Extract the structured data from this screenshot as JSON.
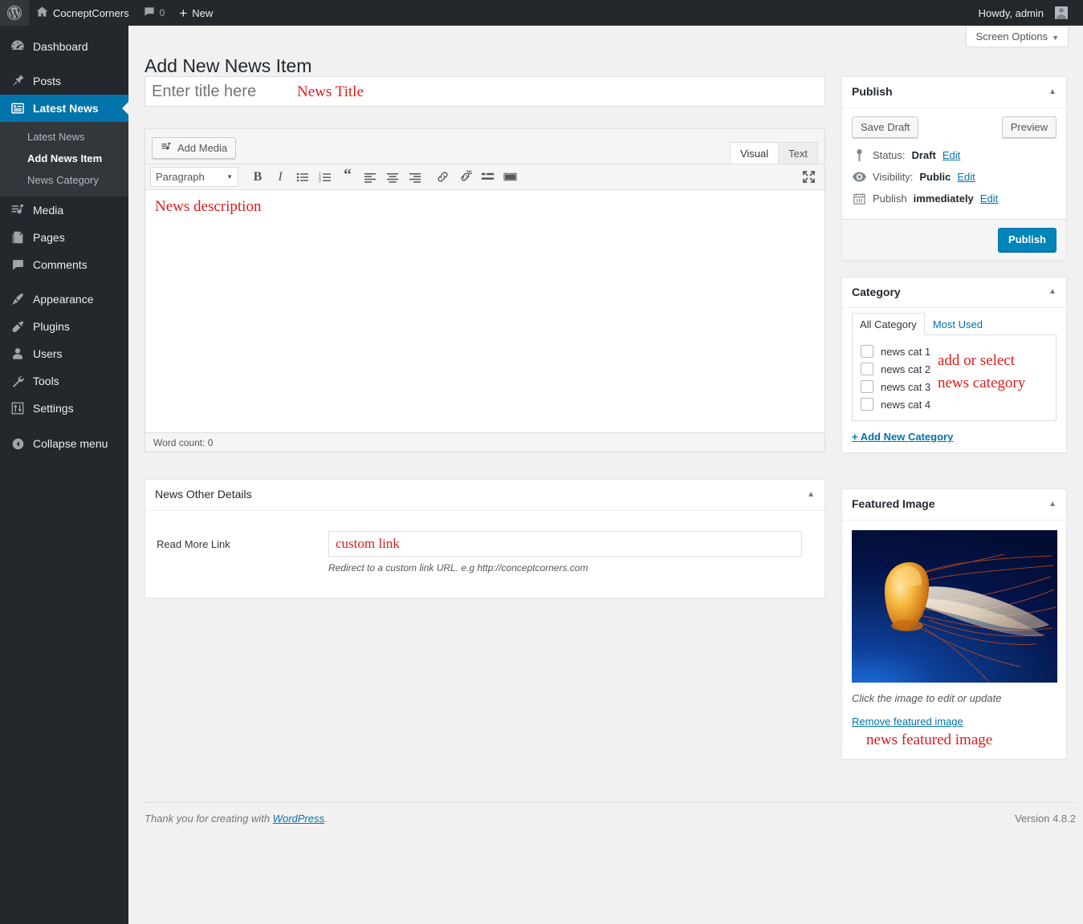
{
  "adminbar": {
    "logo_icon": "wordpress-logo-icon",
    "site_name": "CocneptCorners",
    "site_icon": "home-icon",
    "comments_icon": "comment-bubble-icon",
    "comment_count": "0",
    "new_icon": "plus-icon",
    "new_label": "New",
    "howdy": "Howdy, admin",
    "avatar_icon": "user-avatar-icon"
  },
  "sidebar": {
    "items": [
      {
        "label": "Dashboard",
        "icon": "dashboard-icon",
        "active": false
      },
      {
        "label": "Posts",
        "icon": "pin-icon",
        "active": false
      },
      {
        "label": "Latest News",
        "icon": "list-view-icon",
        "active": true
      },
      {
        "label": "Media",
        "icon": "media-icon",
        "active": false
      },
      {
        "label": "Pages",
        "icon": "pages-icon",
        "active": false
      },
      {
        "label": "Comments",
        "icon": "comment-bubble-icon",
        "active": false
      },
      {
        "label": "Appearance",
        "icon": "paintbrush-icon",
        "active": false
      },
      {
        "label": "Plugins",
        "icon": "plug-icon",
        "active": false
      },
      {
        "label": "Users",
        "icon": "user-icon",
        "active": false
      },
      {
        "label": "Tools",
        "icon": "wrench-icon",
        "active": false
      },
      {
        "label": "Settings",
        "icon": "sliders-icon",
        "active": false
      }
    ],
    "submenu": [
      {
        "label": "Latest News",
        "current": false
      },
      {
        "label": "Add News Item",
        "current": true
      },
      {
        "label": "News Category",
        "current": false
      }
    ],
    "collapse_label": "Collapse menu",
    "collapse_icon": "arrow-left-circle-icon"
  },
  "header": {
    "screen_options_label": "Screen Options",
    "screen_options_caret": "chevron-down-icon",
    "page_title": "Add New News Item"
  },
  "title_field": {
    "placeholder": "Enter title here",
    "value": "",
    "annotation": "News Title"
  },
  "editor": {
    "add_media_label": "Add Media",
    "add_media_icon": "media-add-icon",
    "tabs": [
      {
        "label": "Visual",
        "active": true
      },
      {
        "label": "Text",
        "active": false
      }
    ],
    "format_select": "Paragraph",
    "toolbar_buttons": [
      {
        "name": "bold-icon",
        "glyph": "B"
      },
      {
        "name": "italic-icon",
        "glyph": "I"
      },
      {
        "name": "bulleted-list-icon",
        "glyph": ""
      },
      {
        "name": "numbered-list-icon",
        "glyph": ""
      },
      {
        "name": "blockquote-icon",
        "glyph": "“"
      },
      {
        "name": "align-left-icon",
        "glyph": ""
      },
      {
        "name": "align-center-icon",
        "glyph": ""
      },
      {
        "name": "align-right-icon",
        "glyph": ""
      },
      {
        "name": "link-icon",
        "glyph": ""
      },
      {
        "name": "unlink-icon",
        "glyph": ""
      },
      {
        "name": "read-more-icon",
        "glyph": ""
      },
      {
        "name": "toolbar-toggle-icon",
        "glyph": ""
      }
    ],
    "fullscreen_icon": "fullscreen-icon",
    "body_annotation": "News description",
    "word_count": "Word count: 0"
  },
  "other_details": {
    "title": "News Other Details",
    "toggle_icon": "chevron-up-icon",
    "field_label": "Read More Link",
    "field_value": "custom link",
    "field_description": "Redirect to a custom link URL. e.g http://conceptcorners.com"
  },
  "publish": {
    "title": "Publish",
    "toggle_icon": "chevron-up-icon",
    "save_draft": "Save Draft",
    "preview": "Preview",
    "status_icon": "pin-marker-icon",
    "status_label": "Status:",
    "status_value": "Draft",
    "status_edit": "Edit",
    "visibility_icon": "eye-icon",
    "visibility_label": "Visibility:",
    "visibility_value": "Public",
    "visibility_edit": "Edit",
    "schedule_icon": "calendar-icon",
    "schedule_label": "Publish",
    "schedule_value": "immediately",
    "schedule_edit": "Edit",
    "publish_button": "Publish"
  },
  "category": {
    "title": "Category",
    "toggle_icon": "chevron-up-icon",
    "tabs": [
      {
        "label": "All Category",
        "active": true
      },
      {
        "label": "Most Used",
        "active": false
      }
    ],
    "items": [
      {
        "label": "news cat 1",
        "checked": false
      },
      {
        "label": "news cat 2",
        "checked": false
      },
      {
        "label": "news cat 3",
        "checked": false
      },
      {
        "label": "news cat 4",
        "checked": false
      }
    ],
    "add_new": "+ Add New Category",
    "annotation": "add or select\nnews category",
    "annotation_line1": "add or select",
    "annotation_line2": "news category"
  },
  "featured_image": {
    "title": "Featured Image",
    "toggle_icon": "chevron-up-icon",
    "image_alt": "jellyfish-thumbnail",
    "caption": "Click the image to edit or update",
    "remove_link": "Remove featured image",
    "annotation": "news featured image"
  },
  "footer": {
    "thanks_prefix": "Thank you for creating with ",
    "wordpress_link": "WordPress",
    "thanks_suffix": ".",
    "version": "Version 4.8.2"
  },
  "colors": {
    "admin_blue": "#0073aa",
    "button_blue": "#0085ba",
    "sidebar_bg": "#23282d",
    "submenu_bg": "#32373c",
    "annotation_red": "#e01b1b",
    "page_bg": "#f1f1f1"
  }
}
